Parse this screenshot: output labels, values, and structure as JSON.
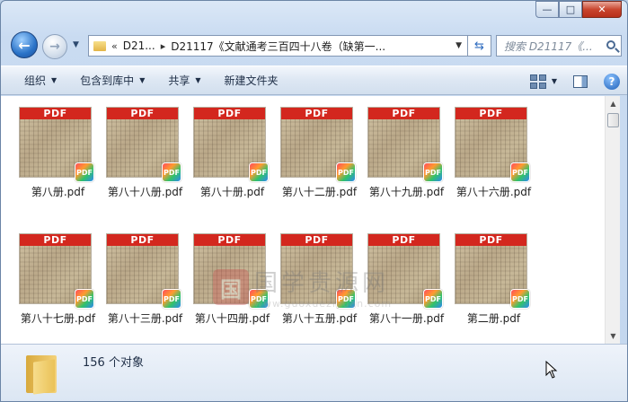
{
  "address": {
    "back_symbol": "«",
    "segments": [
      "D21...",
      "D21117《文献通考三百四十八卷（缺第一..."
    ],
    "separator": "▸"
  },
  "search": {
    "placeholder": "搜索 D21117《..."
  },
  "toolbar": {
    "organize": "组织",
    "include_library": "包含到库中",
    "share": "共享",
    "new_folder": "新建文件夹"
  },
  "files": {
    "row1": [
      {
        "name": "第八册.pdf",
        "badge": "PDF",
        "banner": "PDF"
      },
      {
        "name": "第八十八册.pdf",
        "badge": "PDF",
        "banner": "PDF"
      },
      {
        "name": "第八十册.pdf",
        "badge": "PDF",
        "banner": "PDF"
      },
      {
        "name": "第八十二册.pdf",
        "badge": "PDF",
        "banner": "PDF"
      },
      {
        "name": "第八十九册.pdf",
        "badge": "PDF",
        "banner": "PDF"
      },
      {
        "name": "第八十六册.pdf",
        "badge": "PDF",
        "banner": "PDF"
      }
    ],
    "row2": [
      {
        "name": "第八十七册.pdf",
        "badge": "PDF",
        "banner": "PDF"
      },
      {
        "name": "第八十三册.pdf",
        "badge": "PDF",
        "banner": "PDF"
      },
      {
        "name": "第八十四册.pdf",
        "badge": "PDF",
        "banner": "PDF"
      },
      {
        "name": "第八十五册.pdf",
        "badge": "PDF",
        "banner": "PDF"
      },
      {
        "name": "第八十一册.pdf",
        "badge": "PDF",
        "banner": "PDF"
      },
      {
        "name": "第二册.pdf",
        "badge": "PDF",
        "banner": "PDF"
      }
    ]
  },
  "watermark": {
    "logo": "国",
    "text": "国学贵源网",
    "url": "www.guoxueziyuan.com"
  },
  "details": {
    "item_count": "156 个对象"
  },
  "colors": {
    "pdf_banner": "#d3271e",
    "window_chrome": "#c9dbf1"
  }
}
